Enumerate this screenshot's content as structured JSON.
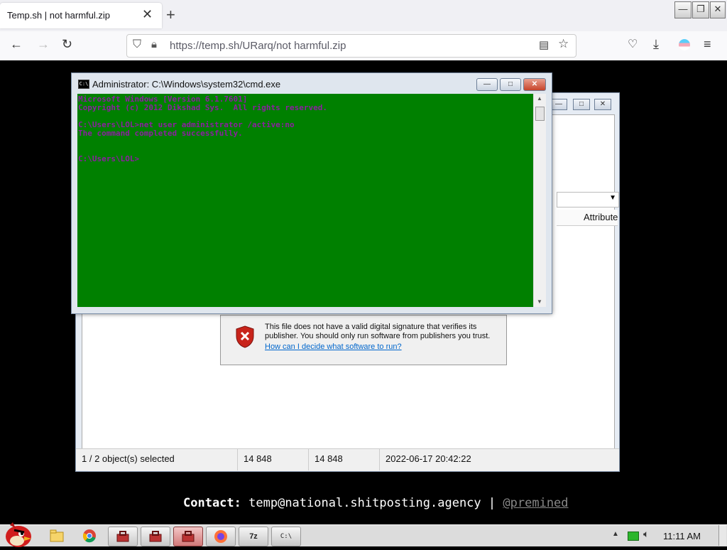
{
  "browser": {
    "tab_title": "Temp.sh | not harmful.zip",
    "tab_close_glyph": "✕",
    "new_tab_glyph": "+",
    "url_host": "https://temp.sh",
    "url_path": "/URarq/not harmful.zip"
  },
  "cmd": {
    "title": "Administrator: C:\\Windows\\system32\\cmd.exe",
    "icon_text": "C:\\",
    "console_text": "Microsoft Windows [Version 6.1.7601]\nCopyright (c) 2012 Dikshad Sys.  All rights reserved.\n\nC:\\Users\\LOL>net user administrator /active:no\nThe command completed successfully.\n\n\nC:\\Users\\LOL>"
  },
  "archive": {
    "column_header": "Attributes",
    "status": {
      "selected": "1 / 2 object(s) selected",
      "size": "14 848",
      "packed": "14 848",
      "modified": "2022-06-17 20:42:22"
    }
  },
  "warning": {
    "text": "This file does not have a valid digital signature that verifies its publisher.  You should only run software from publishers you trust.",
    "link": "How can I decide what software to run?"
  },
  "page": {
    "contact_label": "Contact:",
    "contact_email": "temp@national.shitposting.agency",
    "separator": "|",
    "handle": "@premined"
  },
  "taskbar": {
    "clock": "11:11 AM",
    "seven_zip_label": "7z",
    "cmd_label": "C:\\"
  }
}
